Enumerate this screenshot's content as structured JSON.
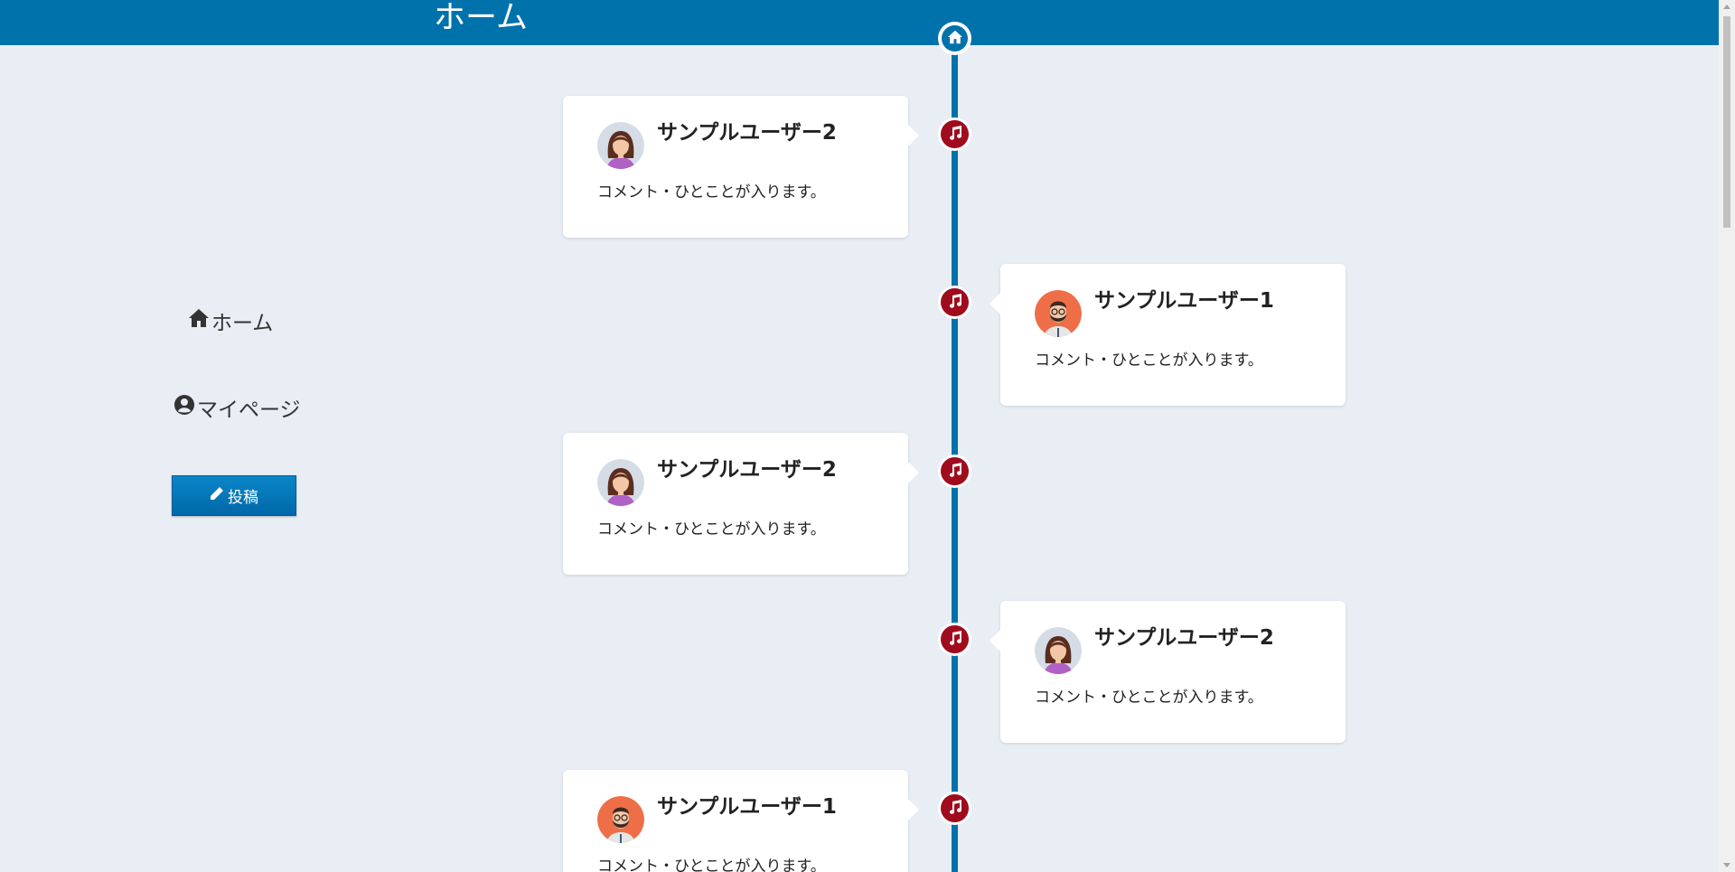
{
  "header": {
    "title": "ホーム"
  },
  "sidebar": {
    "home_label": "ホーム",
    "mypage_label": "マイページ",
    "post_label": "投稿"
  },
  "colors": {
    "brand": "#0072ab",
    "music_node": "#a00b1d",
    "background": "#e8eef4"
  },
  "posts": [
    {
      "user": "サンプルユーザー2",
      "comment": "コメント・ひとことが入ります。",
      "avatar": "female-avatar",
      "side": "left"
    },
    {
      "user": "サンプルユーザー1",
      "comment": "コメント・ひとことが入ります。",
      "avatar": "male-avatar",
      "side": "right"
    },
    {
      "user": "サンプルユーザー2",
      "comment": "コメント・ひとことが入ります。",
      "avatar": "female-avatar",
      "side": "left"
    },
    {
      "user": "サンプルユーザー2",
      "comment": "コメント・ひとことが入ります。",
      "avatar": "female-avatar",
      "side": "right"
    },
    {
      "user": "サンプルユーザー1",
      "comment": "コメント・ひとことが入ります。",
      "avatar": "male-avatar",
      "side": "left"
    }
  ]
}
